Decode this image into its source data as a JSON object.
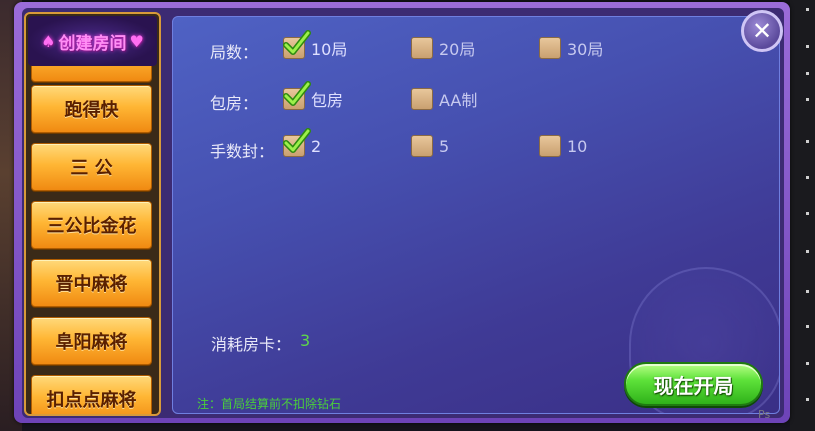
{
  "sidebar": {
    "title": "创建房间",
    "items": [
      {
        "label": "跑得快"
      },
      {
        "label": "三 公"
      },
      {
        "label": "三公比金花"
      },
      {
        "label": "晋中麻将"
      },
      {
        "label": "阜阳麻将"
      },
      {
        "label": "扣点点麻将"
      }
    ]
  },
  "settings": {
    "rounds": {
      "label": "局数：",
      "options": [
        {
          "text": "10局",
          "checked": true
        },
        {
          "text": "20局",
          "checked": false
        },
        {
          "text": "30局",
          "checked": false
        }
      ]
    },
    "room_pay": {
      "label": "包房：",
      "options": [
        {
          "text": "包房",
          "checked": true
        },
        {
          "text": "AA制",
          "checked": false
        }
      ]
    },
    "hand_cap": {
      "label": "手数封：",
      "options": [
        {
          "text": "2",
          "checked": true
        },
        {
          "text": "5",
          "checked": false
        },
        {
          "text": "10",
          "checked": false
        }
      ]
    }
  },
  "cost": {
    "label": "消耗房卡：",
    "value": "3"
  },
  "note": "注：首局结算前不扣除钻石",
  "start_button": "现在开局",
  "close_button": "✕",
  "colors": {
    "panel": "#4650b0",
    "cost_value": "#5ed64a",
    "note": "#4ad03a",
    "check": "#7fe03a"
  }
}
